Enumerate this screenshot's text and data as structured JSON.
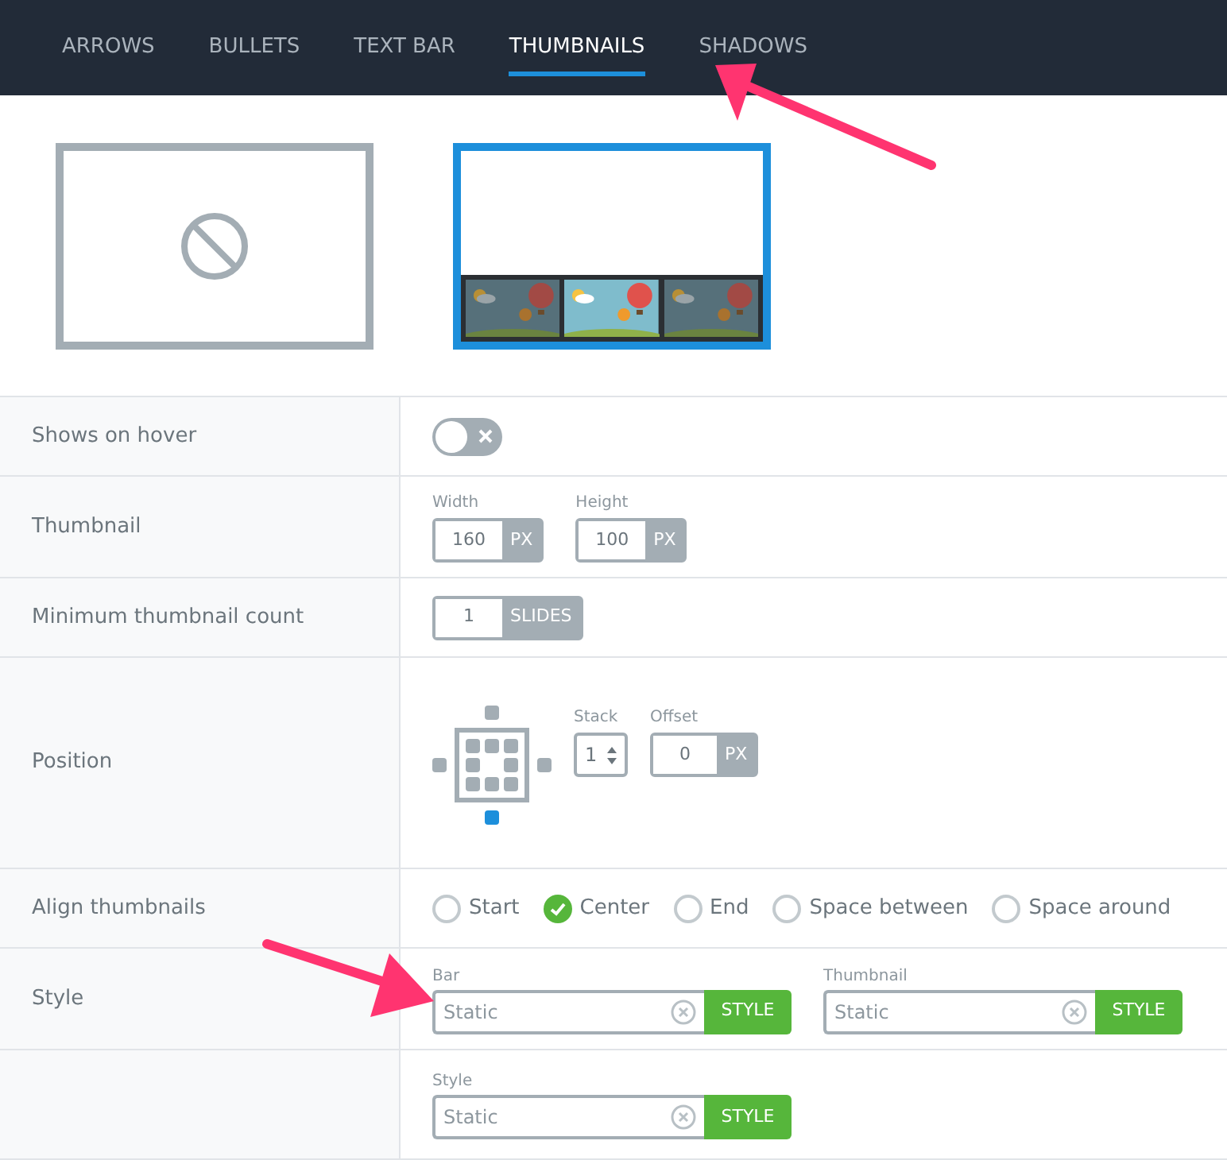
{
  "tabs": [
    {
      "label": "ARROWS",
      "selected": false
    },
    {
      "label": "BULLETS",
      "selected": false
    },
    {
      "label": "TEXT BAR",
      "selected": false
    },
    {
      "label": "THUMBNAILS",
      "selected": true
    },
    {
      "label": "SHADOWS",
      "selected": false
    }
  ],
  "previews": [
    {
      "kind": "none",
      "selected": false
    },
    {
      "kind": "thumbnails",
      "selected": true
    }
  ],
  "rows": [
    {
      "label": "Shows on hover",
      "kind": "toggle",
      "on": false
    },
    {
      "label": "Thumbnail",
      "kind": "units",
      "fields": [
        {
          "label": "Width",
          "value": "160",
          "unit": "PX"
        },
        {
          "label": "Height",
          "value": "100",
          "unit": "PX"
        }
      ]
    },
    {
      "label": "Minimum thumbnail count",
      "kind": "units",
      "fields": [
        {
          "value": "1",
          "unit": "SLIDES"
        }
      ]
    },
    {
      "label": "Position",
      "kind": "position",
      "spots": [
        {
          "selected": false
        },
        {
          "selected": false
        },
        {
          "selected": false
        },
        {
          "selected": false
        },
        {
          "selected": false
        },
        {
          "selected": false
        },
        {
          "selected": false
        },
        {
          "selected": false
        },
        {
          "selected": false
        },
        {
          "selected": false
        },
        {
          "selected": false
        },
        {
          "selected": true
        }
      ],
      "stack": {
        "label": "Stack",
        "value": "1"
      },
      "offset": {
        "label": "Offset",
        "value": "0",
        "unit": "PX"
      }
    },
    {
      "label": "Align thumbnails",
      "kind": "radios",
      "options": [
        {
          "label": "Start",
          "selected": false
        },
        {
          "label": "Center",
          "selected": true
        },
        {
          "label": "End",
          "selected": false
        },
        {
          "label": "Space between",
          "selected": false
        },
        {
          "label": "Space around",
          "selected": false
        }
      ]
    },
    {
      "label": "Style",
      "kind": "styles",
      "fields": [
        {
          "label": "Bar",
          "value": "Static",
          "button": "STYLE"
        },
        {
          "label": "Thumbnail",
          "value": "Static",
          "button": "STYLE"
        }
      ]
    },
    {
      "kind": "styles",
      "fields": [
        {
          "label": "Style",
          "value": "Static",
          "button": "STYLE"
        }
      ]
    }
  ]
}
